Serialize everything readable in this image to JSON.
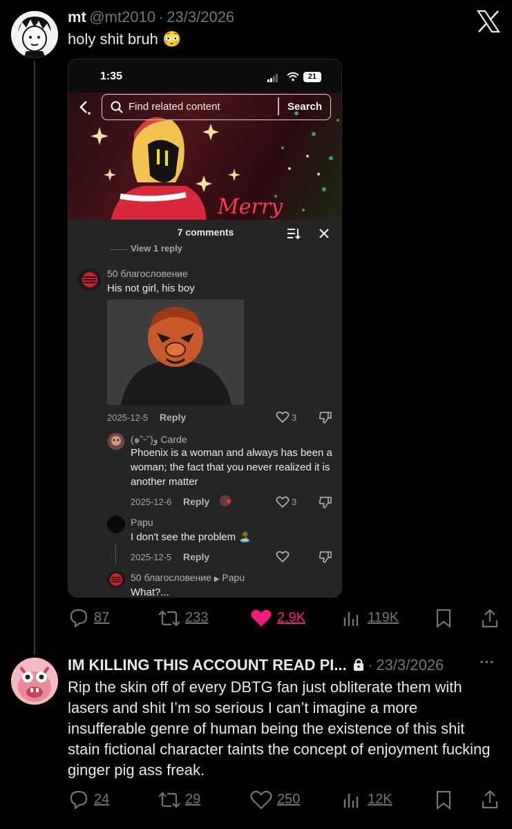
{
  "tweet1": {
    "name": "mt",
    "handle": "@mt2010",
    "dot": "·",
    "date": "23/3/2026",
    "text": "holy shit bruh 😳",
    "replies": "87",
    "retweets": "233",
    "likes": "2.9K",
    "views": "119K"
  },
  "screenshot": {
    "time": "1:35",
    "battery": "21",
    "search_placeholder": "Find related content",
    "search_button": "Search",
    "banner_text": "Merry",
    "comments_title": "7 comments",
    "view_reply": "View 1 reply",
    "comments": [
      {
        "user": "50 благословение",
        "text": "His not girl, his boy",
        "date": "2025-12-5",
        "reply": "Reply",
        "likes": "3"
      },
      {
        "user": "(๑˘ᵕ˘)و Carde",
        "text": "Phoenix is a woman and always has been a woman; the fact that you never realized it is another matter",
        "date": "2025-12-6",
        "reply": "Reply",
        "likes": "3"
      },
      {
        "user": "Papu",
        "text": "I don't see the problem 🏝️",
        "date": "2025-12-5",
        "reply": "Reply",
        "likes": ""
      },
      {
        "user": "50 благословение",
        "reply_to": "Papu",
        "text": "What?...",
        "date": "",
        "reply": "",
        "likes": ""
      }
    ]
  },
  "tweet2": {
    "name": "IM KILLING THIS ACCOUNT READ PI...",
    "dot": "·",
    "date": "23/3/2026",
    "more": "···",
    "text": "Rip the skin off of every DBTG fan just obliterate them with lasers and shit I’m so serious I can’t imagine a more insufferable genre of human being the existence of this shit stain fictional character taints the concept of enjoyment fucking ginger pig ass freak.",
    "replies": "24",
    "retweets": "29",
    "likes": "250",
    "views": "12K"
  },
  "colors": {
    "background": "#000000",
    "text": "#e7e9ea",
    "secondary": "#71767b",
    "like_active": "#f91880"
  }
}
